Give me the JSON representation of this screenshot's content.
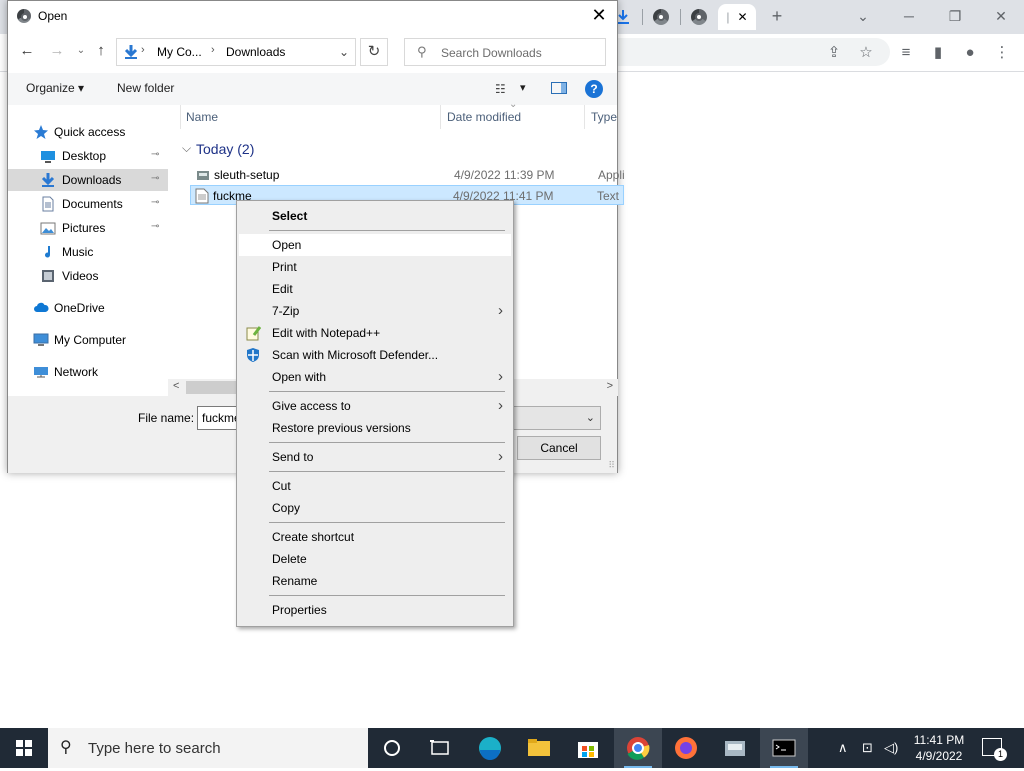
{
  "browser": {
    "window_controls": {
      "minimize": "─",
      "restore": "❐",
      "close": "✕"
    },
    "new_tab": "+",
    "tab_close": "✕",
    "tab_dropdown": "⌄"
  },
  "dialog": {
    "title": "Open",
    "close": "✕",
    "nav": {
      "back": "←",
      "forward": "→",
      "recent": "⌄",
      "up": "↑",
      "refresh": "↻"
    },
    "address": {
      "crumbs": [
        "My Co...",
        "Downloads"
      ],
      "separator": "›",
      "dropdown": "⌄"
    },
    "search": {
      "placeholder": "Search Downloads",
      "icon": "⚲"
    },
    "toolbar": {
      "organize": "Organize ▾",
      "new_folder": "New folder",
      "view_dropdown": "▾",
      "help": "?"
    },
    "nav_pane": [
      {
        "label": "Quick access",
        "icon": "star",
        "color": "#2a7bd4"
      },
      {
        "label": "Desktop",
        "icon": "desktop",
        "pinned": true,
        "color": "#1e90e0"
      },
      {
        "label": "Downloads",
        "icon": "download",
        "pinned": true,
        "selected": true,
        "color": "#2a78d2"
      },
      {
        "label": "Documents",
        "icon": "document",
        "pinned": true,
        "color": "#6a7fa0"
      },
      {
        "label": "Pictures",
        "icon": "pictures",
        "pinned": true,
        "color": "#3d8dd6"
      },
      {
        "label": "Music",
        "icon": "music",
        "color": "#1f7bd0"
      },
      {
        "label": "Videos",
        "icon": "videos",
        "color": "#5a6470"
      },
      {
        "label": "OneDrive",
        "icon": "cloud",
        "color": "#0f78d4"
      },
      {
        "label": "My Computer",
        "icon": "computer",
        "color": "#3e8ed8"
      },
      {
        "label": "Network",
        "icon": "network",
        "color": "#3e8ed8"
      }
    ],
    "pin_glyph": "📌",
    "columns": {
      "name": "Name",
      "date": "Date modified",
      "type": "Type",
      "sort_glyph": "⌄"
    },
    "group": {
      "chevron": "⌵",
      "label": "Today (2)"
    },
    "files": [
      {
        "name": "sleuth-setup",
        "date": "4/9/2022 11:39 PM",
        "type": "Application"
      },
      {
        "name": "fuckme",
        "date": "4/9/2022 11:41 PM",
        "type": "Text Document",
        "selected": true
      }
    ],
    "scroll": {
      "left": "<",
      "right": ">"
    },
    "file_name_label": "File name:",
    "file_name_value": "fuckme",
    "type_dropdown": "⌄",
    "cancel": "Cancel",
    "grip": "⠿"
  },
  "context_menu": {
    "items": [
      {
        "label": "Select",
        "bold": true
      },
      {
        "sep": true
      },
      {
        "label": "Open",
        "hover": true
      },
      {
        "label": "Print"
      },
      {
        "label": "Edit"
      },
      {
        "label": "7-Zip",
        "submenu": true
      },
      {
        "label": "Edit with Notepad++",
        "icon": "notepad-plus-plus"
      },
      {
        "label": "Scan with Microsoft Defender...",
        "icon": "defender"
      },
      {
        "label": "Open with",
        "submenu": true
      },
      {
        "sep": true
      },
      {
        "label": "Give access to",
        "submenu": true
      },
      {
        "label": "Restore previous versions"
      },
      {
        "sep": true
      },
      {
        "label": "Send to",
        "submenu": true
      },
      {
        "sep": true
      },
      {
        "label": "Cut"
      },
      {
        "label": "Copy"
      },
      {
        "sep": true
      },
      {
        "label": "Create shortcut"
      },
      {
        "label": "Delete"
      },
      {
        "label": "Rename"
      },
      {
        "sep": true
      },
      {
        "label": "Properties"
      }
    ],
    "submenu_glyph": "›"
  },
  "taskbar": {
    "search_placeholder": "Type here to search",
    "time": "11:41 PM",
    "date": "4/9/2022",
    "notification_count": "1",
    "tray_chevron": "∧"
  }
}
